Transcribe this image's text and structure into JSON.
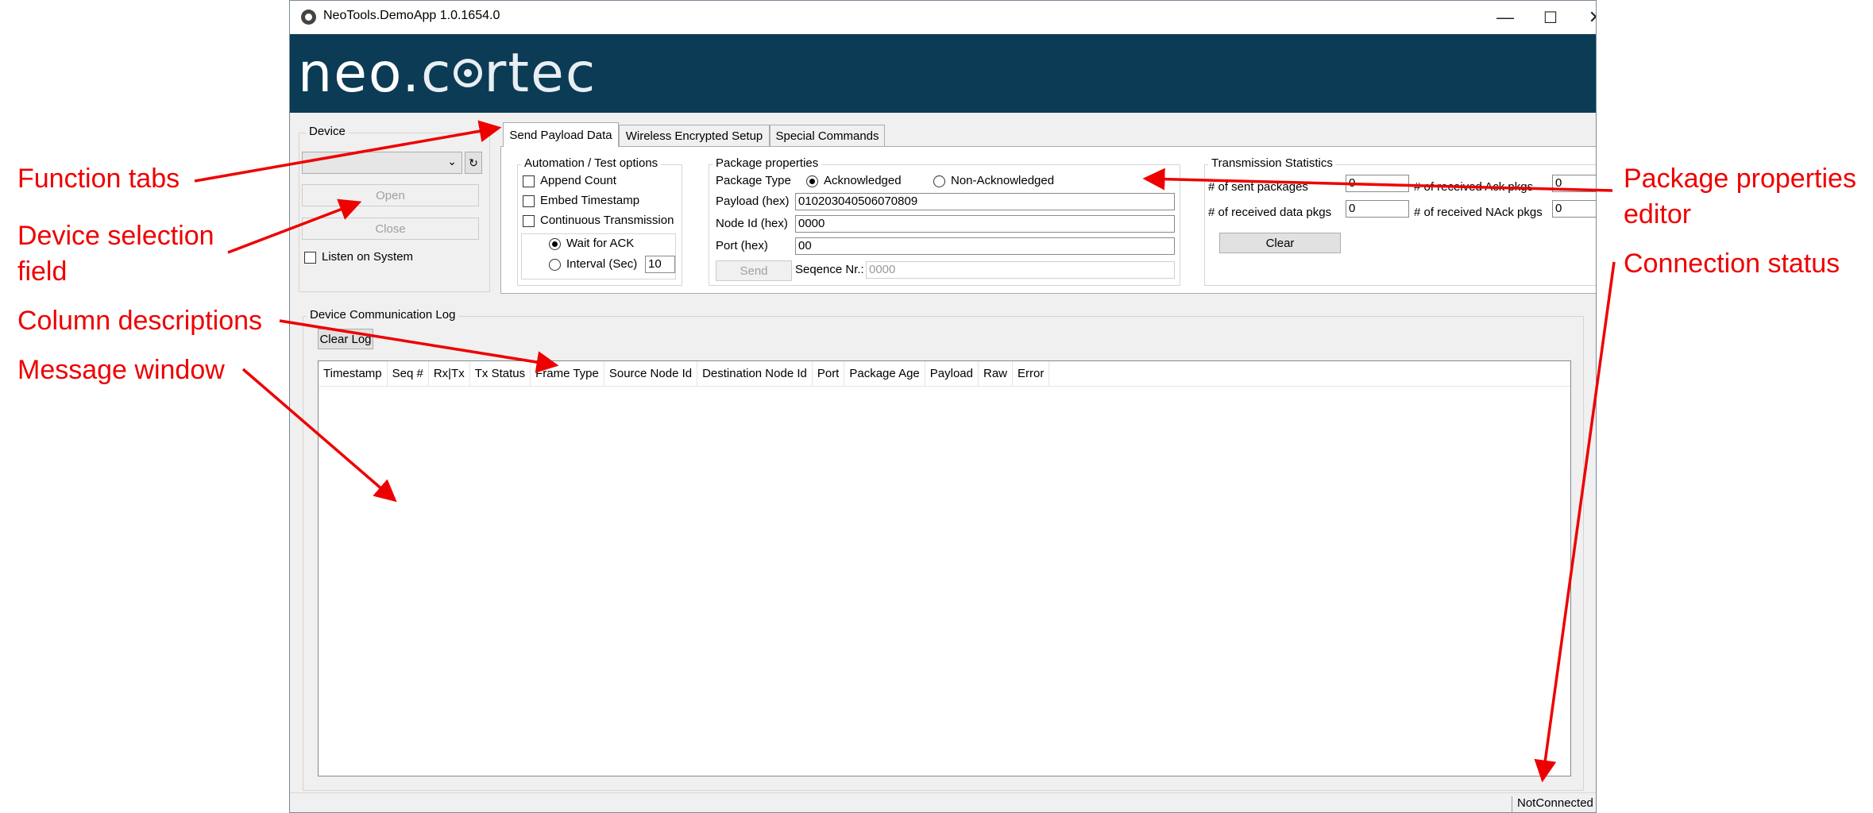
{
  "window": {
    "title": "NeoTools.DemoApp 1.0.1654.0",
    "minimize": "—",
    "maximize": "☐",
    "close": "✕"
  },
  "logo": {
    "part1": "neo.",
    "part2": "c",
    "part3": "rtec"
  },
  "device": {
    "label": "Device",
    "combo_value": "",
    "open": "Open",
    "close": "Close",
    "listen": "Listen on System"
  },
  "tabs": [
    {
      "label": "Send Payload Data",
      "active": true
    },
    {
      "label": "Wireless Encrypted Setup",
      "active": false
    },
    {
      "label": "Special Commands",
      "active": false
    }
  ],
  "automation": {
    "label": "Automation / Test options",
    "append_count": "Append Count",
    "embed_timestamp": "Embed Timestamp",
    "continuous": "Continuous Transmission",
    "wait_ack": "Wait for ACK",
    "interval": "Interval (Sec)",
    "interval_value": "10"
  },
  "package": {
    "label": "Package properties",
    "type_label": "Package Type",
    "acknowledged": "Acknowledged",
    "non_acknowledged": "Non-Acknowledged",
    "payload_label": "Payload (hex)",
    "payload_value": "010203040506070809",
    "node_label": "Node Id (hex)",
    "node_value": "0000",
    "port_label": "Port (hex)",
    "port_value": "00",
    "send": "Send",
    "seq_label": "Seqence Nr.:",
    "seq_value": "0000"
  },
  "stats": {
    "label": "Transmission Statistics",
    "sent": "# of sent packages",
    "sent_value": "0",
    "recv_data": "# of received data pkgs",
    "recv_data_value": "0",
    "recv_ack": "# of received Ack pkgs",
    "recv_ack_value": "0",
    "recv_nack": "# of received NAck pkgs",
    "recv_nack_value": "0",
    "clear": "Clear"
  },
  "log": {
    "label": "Device Communication Log",
    "clear": "Clear Log",
    "columns": [
      "Timestamp",
      "Seq #",
      "Rx|Tx",
      "Tx Status",
      "Frame Type",
      "Source Node Id",
      "Destination Node Id",
      "Port",
      "Package Age",
      "Payload",
      "Raw",
      "Error"
    ]
  },
  "status": {
    "text": "NotConnected"
  },
  "annotations": {
    "function_tabs": "Function tabs",
    "device_selection_1": "Device selection",
    "device_selection_2": "field",
    "column_desc": "Column descriptions",
    "message_window": "Message window",
    "package_editor_1": "Package properties",
    "package_editor_2": "editor",
    "connection_status": "Connection status",
    "color": "#ee0000"
  }
}
